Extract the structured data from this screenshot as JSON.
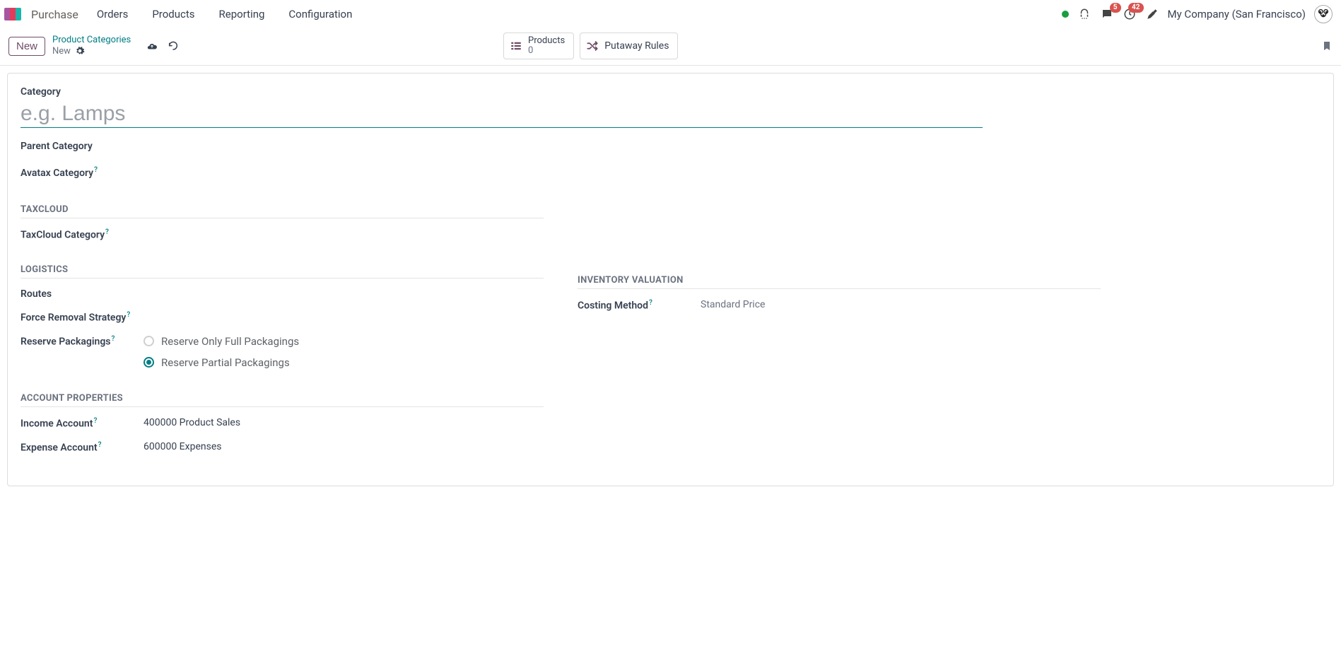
{
  "app": {
    "title": "Purchase"
  },
  "nav": {
    "items": [
      "Orders",
      "Products",
      "Reporting",
      "Configuration"
    ]
  },
  "header": {
    "company": "My Company (San Francisco)",
    "msg_badge": "5",
    "clock_badge": "42"
  },
  "ctrl": {
    "new_label": "New",
    "breadcrumb_top": "Product Categories",
    "breadcrumb_bottom": "New",
    "stat_products_label": "Products",
    "stat_products_count": "0",
    "putaway_label": "Putaway Rules"
  },
  "form": {
    "category_label": "Category",
    "category_placeholder": "e.g. Lamps",
    "category_value": "",
    "parent_category_label": "Parent Category",
    "avatax_label": "Avatax Category",
    "sections": {
      "taxcloud": "TAXCLOUD",
      "logistics": "LOGISTICS",
      "inv_val": "INVENTORY VALUATION",
      "acct": "ACCOUNT PROPERTIES"
    },
    "taxcloud_cat_label": "TaxCloud Category",
    "routes_label": "Routes",
    "force_removal_label": "Force Removal Strategy",
    "reserve_pack_label": "Reserve Packagings",
    "reserve_opts": {
      "full": "Reserve Only Full Packagings",
      "partial": "Reserve Partial Packagings",
      "selected": "partial"
    },
    "costing_label": "Costing Method",
    "costing_value": "Standard Price",
    "income_label": "Income Account",
    "income_value": "400000 Product Sales",
    "expense_label": "Expense Account",
    "expense_value": "600000 Expenses"
  }
}
